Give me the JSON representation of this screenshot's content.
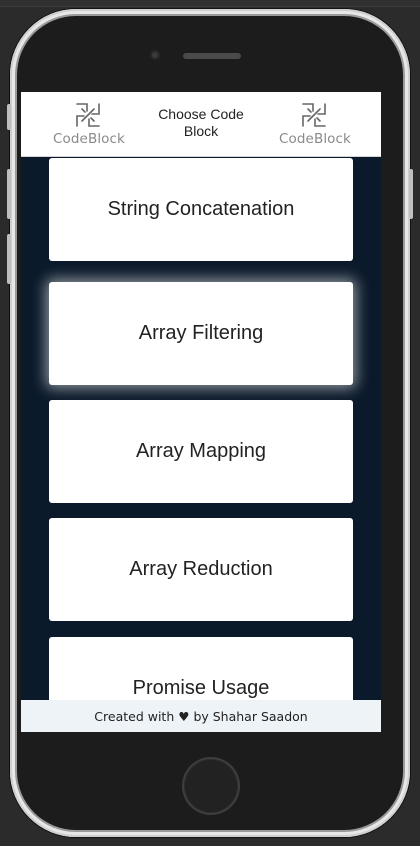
{
  "header": {
    "logo_left_text": "CodeBlock",
    "logo_right_text": "CodeBlock",
    "title": "Choose Code Block"
  },
  "code_blocks": [
    {
      "label": "String Concatenation"
    },
    {
      "label": "Array Filtering"
    },
    {
      "label": "Array Mapping"
    },
    {
      "label": "Array Reduction"
    },
    {
      "label": "Promise Usage"
    }
  ],
  "footer": {
    "prefix": "Created with",
    "heart_icon": "heart-icon",
    "suffix": "by Shahar Saadon"
  },
  "colors": {
    "screen_background": "#0b1a2b",
    "card_background": "#ffffff",
    "footer_background": "#eef3f7",
    "phone_frame": "#1c1c1c"
  }
}
